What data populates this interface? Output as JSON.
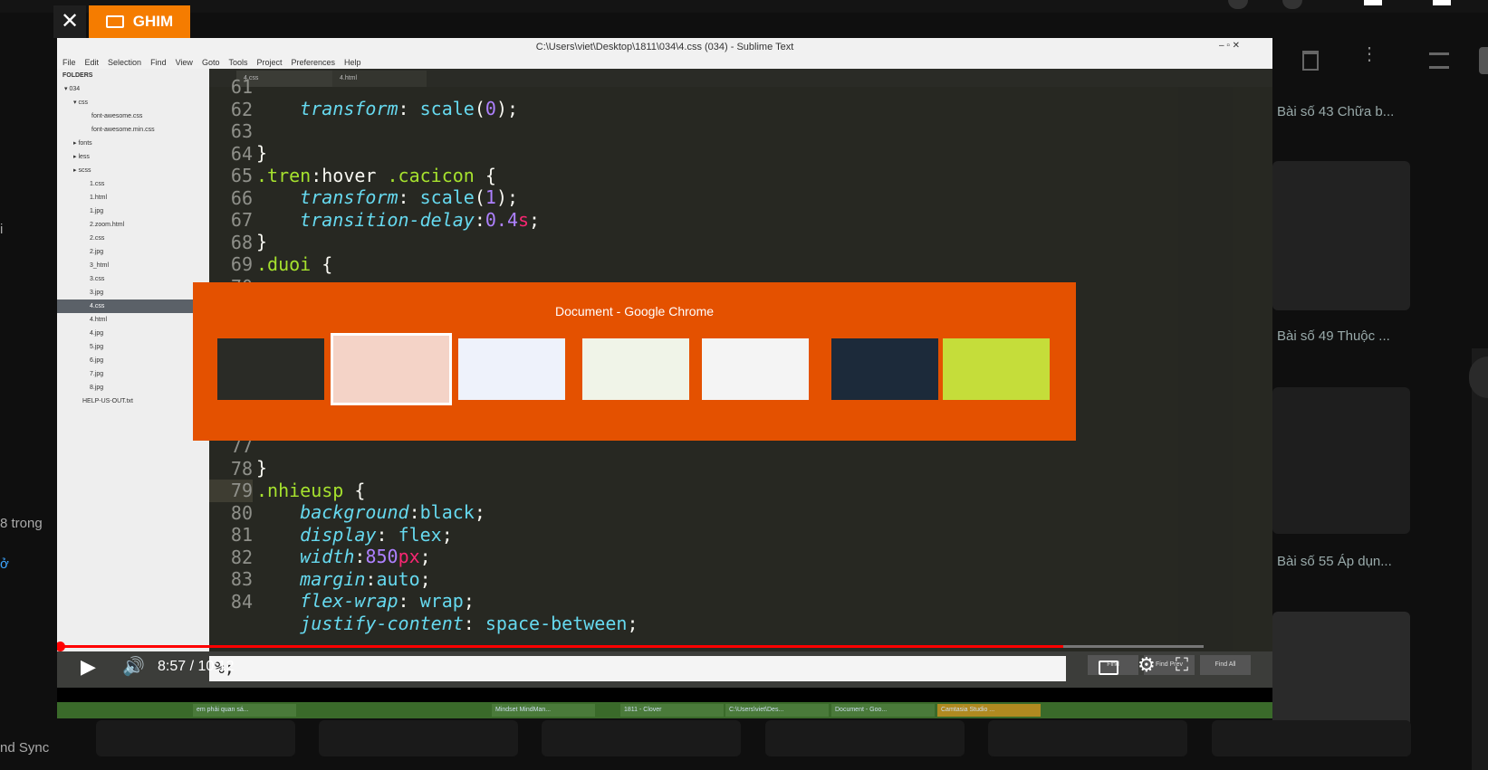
{
  "pin": {
    "close": "✕",
    "label": "GHIM"
  },
  "background": {
    "left_texts": [
      "i",
      "8 trong",
      "ở",
      "nd Sync"
    ],
    "suggestions": [
      {
        "title": "Bài số 43 Chữa b..."
      },
      {
        "title": "Bài số 49 Thuộc ..."
      },
      {
        "title": "Bài số 55 Áp dụn..."
      }
    ]
  },
  "sublime": {
    "title": "C:\\Users\\viet\\Desktop\\1811\\034\\4.css (034) - Sublime Text",
    "menu": [
      "File",
      "Edit",
      "Selection",
      "Find",
      "View",
      "Goto",
      "Tools",
      "Project",
      "Preferences",
      "Help"
    ],
    "folders_label": "FOLDERS",
    "tree": [
      "034",
      "css",
      "font-awesome.css",
      "font-awesome.min.css",
      "fonts",
      "less",
      "scss",
      "1.css",
      "1.html",
      "1.jpg",
      "2.zoom.html",
      "2.css",
      "2.jpg",
      "3_html",
      "3.css",
      "3.jpg",
      "4.css",
      "4.html",
      "4.jpg",
      "5.jpg",
      "6.jpg",
      "7.jpg",
      "8.jpg",
      "HELP-US-OUT.txt"
    ],
    "tabs": [
      "4.css",
      "4.html"
    ],
    "line_numbers_top": [
      "61",
      "62",
      "63",
      "64",
      "65",
      "66",
      "67",
      "68",
      "69",
      "70"
    ],
    "line_numbers_bottom": [
      "77",
      "78",
      "79",
      "80",
      "81",
      "82",
      "83",
      "84"
    ],
    "find_value": "%;",
    "find_buttons": [
      "Find",
      "Find Prev",
      "Find All"
    ]
  },
  "switcher": {
    "title": "Document - Google Chrome"
  },
  "taskbar": [
    "em phải quan sá...",
    "Mindset MindMan...",
    "1811 - Clover",
    "C:\\Users\\viet\\Des...",
    "Document - Goo...",
    "Camtasia Studio ..."
  ],
  "controls": {
    "time": "8:57 / 10:12",
    "progress": 0.877
  },
  "colors": {
    "accent": "#f57c00",
    "progress": "#ff0000",
    "switcher": "#e45100",
    "editor": "#272822"
  }
}
